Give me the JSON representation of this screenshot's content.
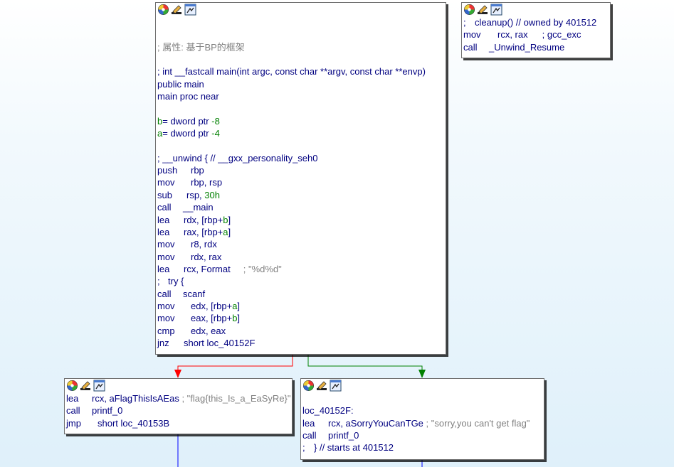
{
  "colors": {
    "edge_false": "#ff0000",
    "edge_true": "#008000",
    "edge_plain": "#0000ff",
    "text_default": "#000080",
    "comment": "#808080",
    "stack_var": "#008000"
  },
  "node_header_icons": [
    "color-wheel-icon",
    "edit-pencil-icon",
    "graph-overview-icon"
  ],
  "main_block": {
    "attr_comment": "; 属性: 基于BP的框架",
    "prototype": "; int __fastcall main(int argc, const char **argv, const char **envp)",
    "public_line": "public main",
    "proc_line": "main proc near",
    "var_b_name": "b",
    "var_b_def": "= dword ptr ",
    "var_b_off": "-8",
    "var_a_name": "a",
    "var_a_def": "= dword ptr ",
    "var_a_off": "-4",
    "unwind_line": "; __unwind { // __gxx_personality_seh0",
    "instr": [
      {
        "m": "push",
        "o": "rbp"
      },
      {
        "m": "mov",
        "o": "rbp, rsp"
      },
      {
        "m": "sub",
        "o": "rsp, ",
        "imm": "30h"
      },
      {
        "m": "call",
        "o": "__main"
      },
      {
        "m": "lea",
        "o": "rdx, [rbp+",
        "var": "b",
        "tail": "]"
      },
      {
        "m": "lea",
        "o": "rax, [rbp+",
        "var": "a",
        "tail": "]"
      },
      {
        "m": "mov",
        "o": "r8, rdx"
      },
      {
        "m": "mov",
        "o": "rdx, rax"
      },
      {
        "m": "lea",
        "o": "rcx, Format",
        "cmt": "; \"%d%d\""
      },
      {
        "m": ";",
        "o": "try {",
        "is_comment_line": true
      },
      {
        "m": "call",
        "o": "scanf"
      },
      {
        "m": "mov",
        "o": "edx, [rbp+",
        "var": "a",
        "tail": "]"
      },
      {
        "m": "mov",
        "o": "eax, [rbp+",
        "var": "b",
        "tail": "]"
      },
      {
        "m": "cmp",
        "o": "edx, eax"
      },
      {
        "m": "jnz",
        "o": "short loc_40152F"
      }
    ]
  },
  "cleanup_block": {
    "line1_mn": ";",
    "line1_op": "cleanup() // owned by 401512",
    "line2_mn": "mov",
    "line2_op": "rcx, rax",
    "line2_cmt": "; gcc_exc",
    "line3_mn": "call",
    "line3_op": "_Unwind_Resume"
  },
  "flag_block": {
    "l1_mn": "lea",
    "l1_op": "rcx, aFlagThisIsAEas",
    "l1_cmt": "; \"flag{this_Is_a_EaSyRe}\"",
    "l2_mn": "call",
    "l2_op": "printf_0",
    "l3_mn": "jmp",
    "l3_op": "short loc_40153B"
  },
  "sorry_block": {
    "label": "loc_40152F:",
    "l1_mn": "lea",
    "l1_op": "rcx, aSorryYouCanTGe",
    "l1_cmt": "; \"sorry,you can't get flag\"",
    "l2_mn": "call",
    "l2_op": "printf_0",
    "l3_mn": ";",
    "l3_op": "} // starts at 401512"
  }
}
